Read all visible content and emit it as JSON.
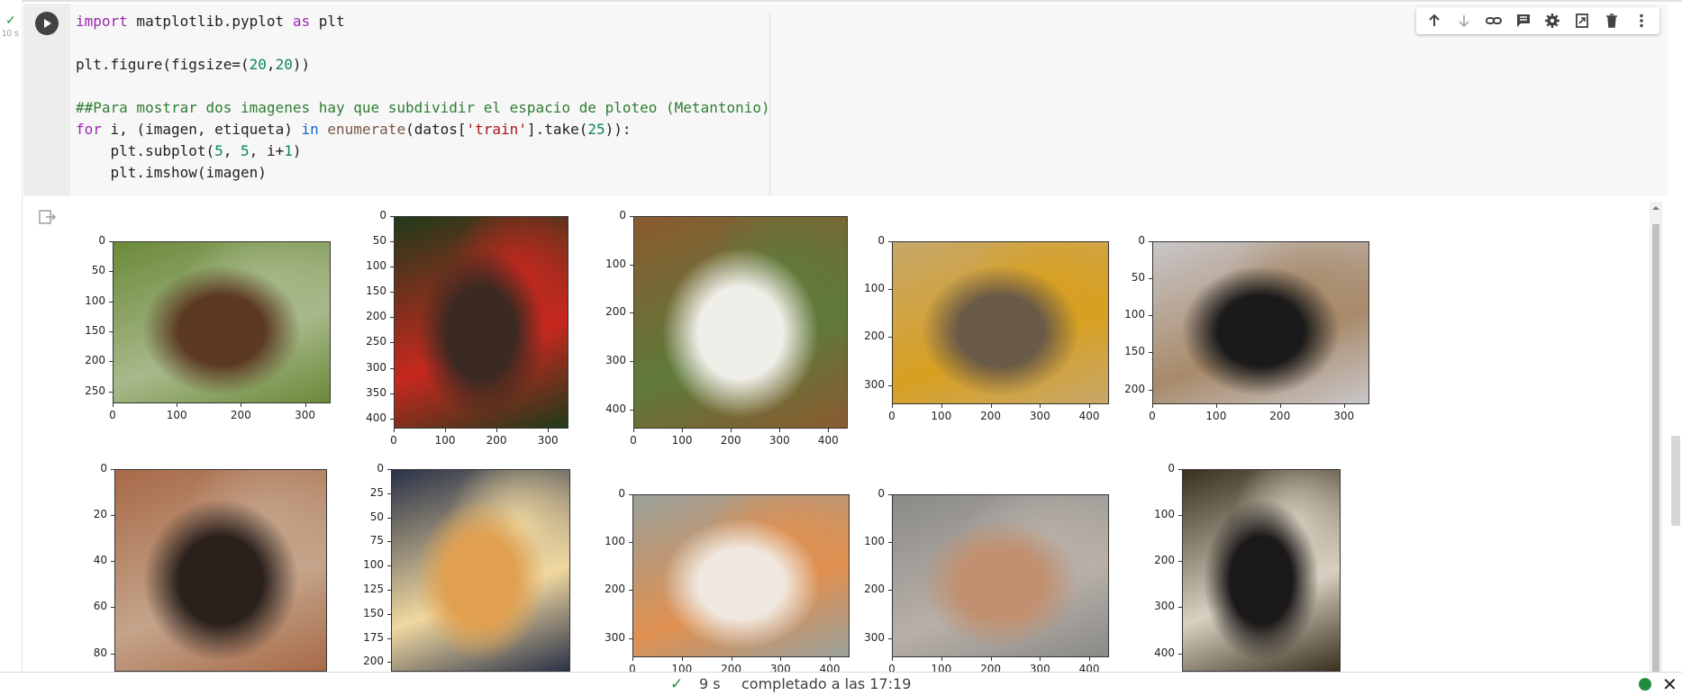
{
  "cell": {
    "exec_time": "10 s",
    "code_lines": [
      [
        {
          "t": "import",
          "c": "kw"
        },
        {
          "t": " matplotlib.pyplot ",
          "c": ""
        },
        {
          "t": "as",
          "c": "kw"
        },
        {
          "t": " plt",
          "c": ""
        }
      ],
      [],
      [
        {
          "t": "plt.figure(figsize=(",
          "c": ""
        },
        {
          "t": "20",
          "c": "num"
        },
        {
          "t": ",",
          "c": ""
        },
        {
          "t": "20",
          "c": "num"
        },
        {
          "t": "))",
          "c": ""
        }
      ],
      [],
      [
        {
          "t": "##Para mostrar dos imagenes hay que subdividir el espacio de ploteo (Metantonio)",
          "c": "cmt"
        }
      ],
      [
        {
          "t": "for",
          "c": "kw"
        },
        {
          "t": " i, (imagen, etiqueta) ",
          "c": ""
        },
        {
          "t": "in",
          "c": "kw2"
        },
        {
          "t": " ",
          "c": ""
        },
        {
          "t": "enumerate",
          "c": "fn"
        },
        {
          "t": "(datos[",
          "c": ""
        },
        {
          "t": "'train'",
          "c": "str"
        },
        {
          "t": "].take(",
          "c": ""
        },
        {
          "t": "25",
          "c": "num"
        },
        {
          "t": ")):",
          "c": ""
        }
      ],
      [
        {
          "t": "    plt.subplot(",
          "c": ""
        },
        {
          "t": "5",
          "c": "num"
        },
        {
          "t": ", ",
          "c": ""
        },
        {
          "t": "5",
          "c": "num"
        },
        {
          "t": ", i+",
          "c": ""
        },
        {
          "t": "1",
          "c": "num"
        },
        {
          "t": ")",
          "c": ""
        }
      ],
      [
        {
          "t": "    plt.imshow(imagen)",
          "c": ""
        }
      ]
    ]
  },
  "toolbar": {
    "items": [
      "arrow-up-icon",
      "arrow-down-icon",
      "link-icon",
      "comment-icon",
      "gear-icon",
      "mirror-cell-icon",
      "trash-icon",
      "more-vert-icon"
    ]
  },
  "plots": [
    {
      "name": "boxer-dog",
      "yticks": [
        "0",
        "50",
        "100",
        "150",
        "200",
        "250"
      ],
      "xticks": [
        "0",
        "100",
        "200",
        "300"
      ],
      "colors": [
        "#6b8a3a",
        "#5c3a22",
        "#a8b98a"
      ]
    },
    {
      "name": "chihuahua-christmas",
      "yticks": [
        "0",
        "50",
        "100",
        "150",
        "200",
        "250",
        "300",
        "350",
        "400"
      ],
      "xticks": [
        "0",
        "100",
        "200",
        "300"
      ],
      "colors": [
        "#1f3a1a",
        "#3b2a22",
        "#c8281e"
      ]
    },
    {
      "name": "beagle",
      "yticks": [
        "0",
        "100",
        "200",
        "300",
        "400"
      ],
      "xticks": [
        "0",
        "100",
        "200",
        "300",
        "400"
      ],
      "colors": [
        "#8a5a30",
        "#f0eee8",
        "#5e7a3a"
      ]
    },
    {
      "name": "tabby-cat",
      "yticks": [
        "0",
        "100",
        "200",
        "300"
      ],
      "xticks": [
        "0",
        "100",
        "200",
        "300",
        "400"
      ],
      "colors": [
        "#c7a86a",
        "#6a5a48",
        "#d8a020"
      ]
    },
    {
      "name": "black-white-dog",
      "yticks": [
        "0",
        "50",
        "100",
        "150",
        "200"
      ],
      "xticks": [
        "0",
        "100",
        "200",
        "300"
      ],
      "colors": [
        "#c9c6c8",
        "#1a1a1a",
        "#a88a6a"
      ]
    },
    {
      "name": "dark-dog-doorway",
      "yticks": [
        "0",
        "20",
        "40",
        "60",
        "80"
      ],
      "xticks": [],
      "colors": [
        "#a86a48",
        "#2a201c",
        "#c4a48a"
      ]
    },
    {
      "name": "orange-kittens",
      "yticks": [
        "0",
        "25",
        "50",
        "75",
        "100",
        "125",
        "150",
        "175",
        "200"
      ],
      "xticks": [],
      "colors": [
        "#2a3248",
        "#e0a050",
        "#f0d8a0"
      ]
    },
    {
      "name": "cat-in-cage",
      "yticks": [
        "0",
        "100",
        "200",
        "300"
      ],
      "xticks": [
        "0",
        "100",
        "200",
        "300",
        "400"
      ],
      "colors": [
        "#9aa09a",
        "#f0e8e0",
        "#e09050"
      ]
    },
    {
      "name": "dog-behind-fence",
      "yticks": [
        "0",
        "100",
        "200",
        "300"
      ],
      "xticks": [
        "0",
        "100",
        "200",
        "300",
        "400"
      ],
      "colors": [
        "#8a8a88",
        "#c09070",
        "#b8b0a8"
      ]
    },
    {
      "name": "dog-in-store",
      "yticks": [
        "0",
        "100",
        "200",
        "300",
        "400"
      ],
      "xticks": [],
      "colors": [
        "#3a3020",
        "#1a1818",
        "#d8d0c0"
      ]
    }
  ],
  "status": {
    "time": "9 s",
    "text": "completado a las 17:19"
  }
}
